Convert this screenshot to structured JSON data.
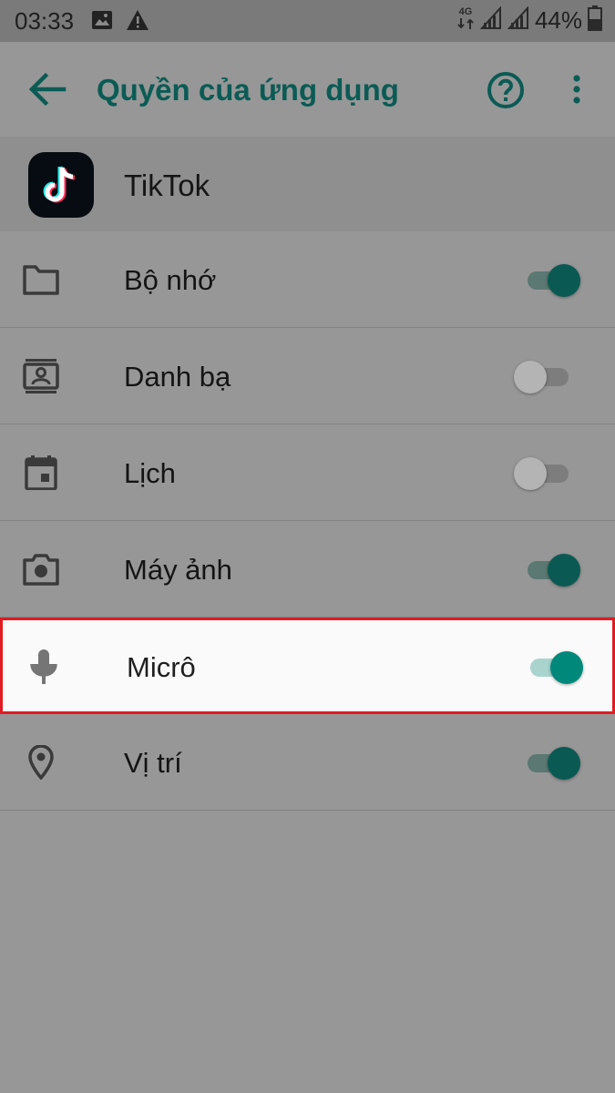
{
  "status_bar": {
    "time": "03:33",
    "network": "4G",
    "battery": "44%"
  },
  "toolbar": {
    "title": "Quyền của ứng dụng",
    "icons": {
      "back": "arrow-left-icon",
      "help": "help-circle-icon",
      "more": "more-vertical-icon"
    }
  },
  "app": {
    "name": "TikTok",
    "icon": "tiktok-logo"
  },
  "permissions": [
    {
      "label": "Bộ nhớ",
      "icon": "folder-icon",
      "enabled": true
    },
    {
      "label": "Danh bạ",
      "icon": "contacts-icon",
      "enabled": false
    },
    {
      "label": "Lịch",
      "icon": "calendar-icon",
      "enabled": false
    },
    {
      "label": "Máy ảnh",
      "icon": "camera-icon",
      "enabled": true
    },
    {
      "label": "Micrô",
      "icon": "microphone-icon",
      "enabled": true,
      "highlighted": true
    },
    {
      "label": "Vị trí",
      "icon": "location-icon",
      "enabled": true
    }
  ],
  "colors": {
    "accent": "#0b5b55",
    "toggle_on_active": "#00897b",
    "highlight_border": "#e21b23",
    "dim_background": "#979797"
  }
}
